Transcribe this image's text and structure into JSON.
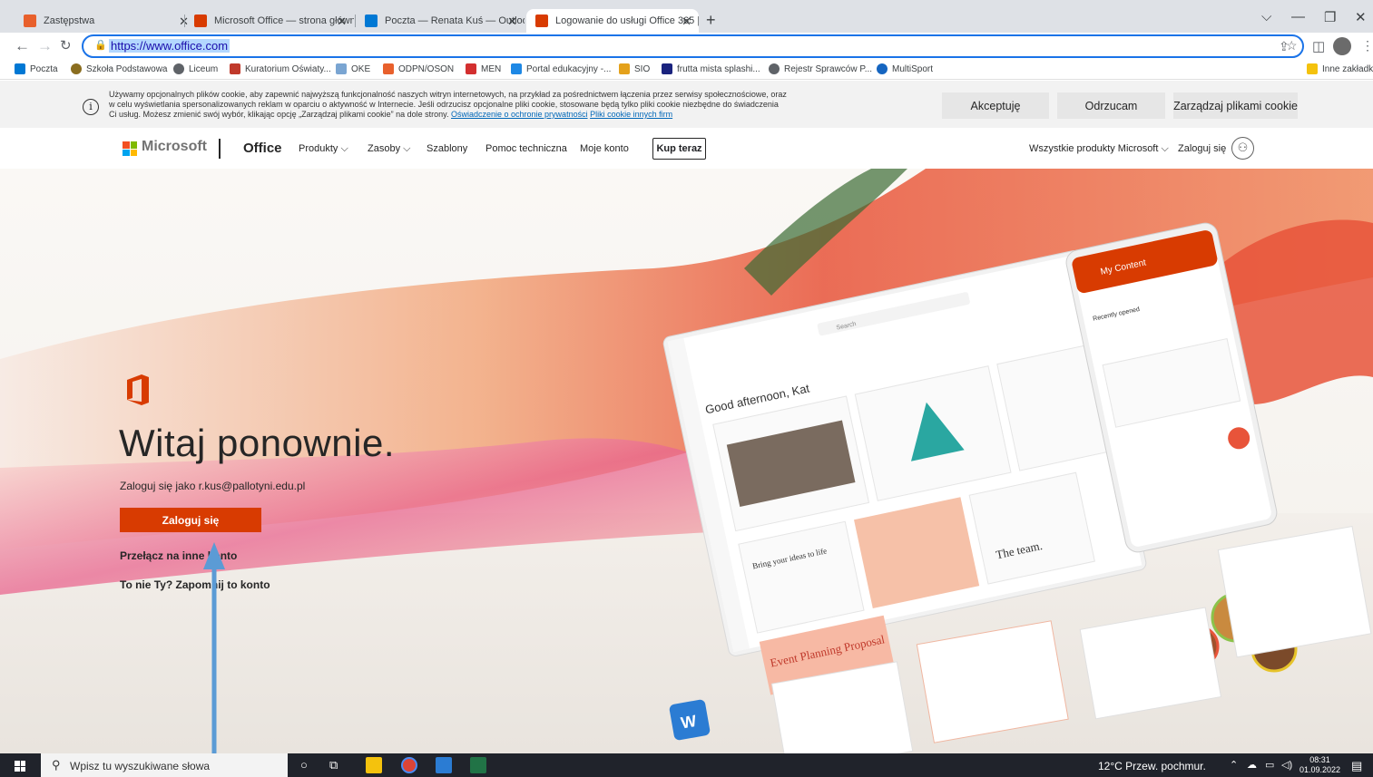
{
  "browser": {
    "tabs": [
      {
        "title": "Zastępstwa",
        "favicon_color": "#e8602c",
        "active": false
      },
      {
        "title": "Microsoft Office — strona główn",
        "favicon_color": "#d83b01",
        "active": false
      },
      {
        "title": "Poczta — Renata Kuś — Outlook",
        "favicon_color": "#0078d4",
        "active": false
      },
      {
        "title": "Logowanie do usługi Office 365 |",
        "favicon_color": "#d83b01",
        "active": true
      }
    ],
    "new_tab_symbol": "+",
    "close_symbol": "✕",
    "url": "https://www.office.com",
    "bookmarks": [
      {
        "label": "Poczta",
        "color": "#0078d4"
      },
      {
        "label": "Szkoła Podstawowa",
        "color": "#8a6d1f"
      },
      {
        "label": "Liceum",
        "color": "#5f6368"
      },
      {
        "label": "Kuratorium Oświaty...",
        "color": "#c0392b"
      },
      {
        "label": "OKE",
        "color": "#7aa5d2"
      },
      {
        "label": "ODPN/OSON",
        "color": "#e8602c"
      },
      {
        "label": "MEN",
        "color": "#d32f2f"
      },
      {
        "label": "Portal edukacyjny -...",
        "color": "#1e88e5"
      },
      {
        "label": "SIO",
        "color": "#e4a11b"
      },
      {
        "label": "frutta mista splashi...",
        "color": "#1a237e"
      },
      {
        "label": "Rejestr Sprawców P...",
        "color": "#5f6368"
      },
      {
        "label": "MultiSport",
        "color": "#1565c0"
      },
      {
        "label": "Inne zakładki",
        "color": "#f4c20d"
      }
    ]
  },
  "cookie_banner": {
    "line1": "Używamy opcjonalnych plików cookie, aby zapewnić najwyższą funkcjonalność naszych witryn internetowych, na przykład za pośrednictwem łączenia przez serwisy społecznościowe, oraz",
    "line2": "w celu wyświetlania spersonalizowanych reklam w oparciu o aktywność w Internecie. Jeśli odrzucisz opcjonalne pliki cookie, stosowane będą tylko pliki cookie niezbędne do świadczenia",
    "line3": "Ci usług. Możesz zmienić swój wybór, klikając opcję „Zarządzaj plikami cookie” na dole strony.",
    "privacy_link": "Oświadczenie o ochronie prywatności",
    "third_party_link": "Pliki cookie innych firm",
    "accept": "Akceptuję",
    "reject": "Odrzucam",
    "manage": "Zarządzaj plikami cookie"
  },
  "ms_nav": {
    "brand": "Microsoft",
    "product": "Office",
    "links": [
      "Produkty ⌵",
      "Zasoby ⌵",
      "Szablony",
      "Pomoc techniczna",
      "Moje konto"
    ],
    "buy_now": "Kup teraz",
    "all_products": "Wszystkie produkty Microsoft ⌵",
    "sign_in": "Zaloguj się"
  },
  "hero": {
    "heading": "Witaj ponownie.",
    "login_as": "Zaloguj się jako r.kus@pallotyni.edu.pl",
    "login_button": "Zaloguj się",
    "switch_account": "Przełącz na inne konto",
    "forget": "To nie Ty? Zapomnij to konto",
    "mockup": {
      "greeting": "Good afternoon, Kat",
      "search": "Search",
      "my_content": "My Content",
      "recently_opened": "Recently opened",
      "bring_ideas": "Bring your ideas to life",
      "event_planning": "Event Planning Proposal",
      "the_team": "The team."
    }
  },
  "taskbar": {
    "search_placeholder": "Wpisz tu wyszukiwane słowa",
    "weather": "12°C  Przew. pochmur.",
    "time": "08:31",
    "date": "01.09.2022"
  }
}
